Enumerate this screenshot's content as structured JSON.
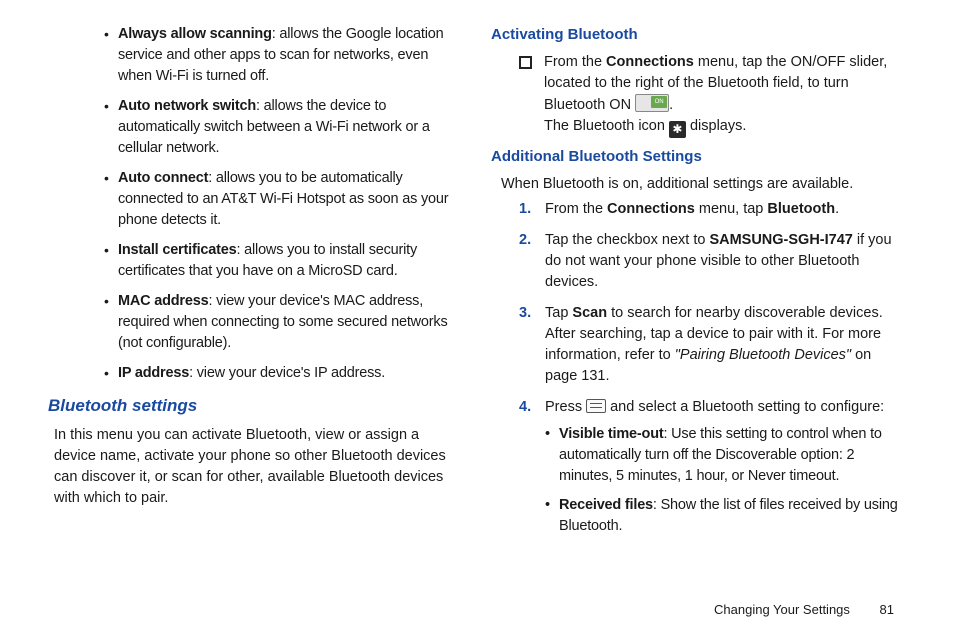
{
  "left": {
    "bullets": [
      {
        "t": "Always allow scanning",
        "d": ": allows the Google location service and other apps to scan for networks, even when Wi-Fi is turned off."
      },
      {
        "t": "Auto network switch",
        "d": ": allows the device to automatically switch between a Wi-Fi network or a cellular network."
      },
      {
        "t": "Auto connect",
        "d": ": allows you to be automatically connected to an AT&T Wi-Fi Hotspot as soon as your phone detects it."
      },
      {
        "t": "Install certificates",
        "d": ": allows you to install security certificates that you have on a MicroSD card."
      },
      {
        "t": "MAC address",
        "d": ": view your device's MAC address, required when connecting to some secured networks (not configurable)."
      },
      {
        "t": "IP address",
        "d": ": view your device's IP address."
      }
    ],
    "bt_heading": "Bluetooth settings",
    "bt_para": "In this menu you can activate Bluetooth, view or assign a device name, activate your phone so other Bluetooth devices can discover it, or scan for other, available Bluetooth devices with which to pair."
  },
  "right": {
    "act_heading": "Activating Bluetooth",
    "act_line1a": "From the ",
    "act_line1b": "Connections",
    "act_line1c": " menu, tap the ON/OFF slider, located to the right of the Bluetooth field, to turn Bluetooth ON ",
    "act_line1d": ".",
    "act_on_label": "ON",
    "act_line2a": "The Bluetooth icon ",
    "act_line2b": " displays.",
    "addl_heading": "Additional Bluetooth Settings",
    "addl_intro": "When Bluetooth is on, additional settings are available.",
    "s1a": "From the ",
    "s1b": "Connections",
    "s1c": " menu, tap ",
    "s1d": "Bluetooth",
    "s1e": ".",
    "s2a": "Tap the checkbox next to ",
    "s2b": "SAMSUNG-SGH-I747",
    "s2c": " if you do not want your phone visible to other Bluetooth devices.",
    "s3a": "Tap ",
    "s3b": "Scan",
    "s3c": " to search for nearby discoverable devices. After searching, tap a device to pair with it. For more information, refer to ",
    "s3d": "\"Pairing Bluetooth Devices\"",
    "s3e": "  on page 131.",
    "s4a": "Press ",
    "s4b": " and select a Bluetooth setting to configure:",
    "sub": [
      {
        "t": "Visible time-out",
        "d": ": Use this setting to control when to automatically turn off the Discoverable option: 2 minutes, 5 minutes, 1 hour, or Never timeout."
      },
      {
        "t": "Received files",
        "d": ": Show the list of files received by using Bluetooth."
      }
    ]
  },
  "footer": {
    "section": "Changing Your Settings",
    "page": "81"
  }
}
